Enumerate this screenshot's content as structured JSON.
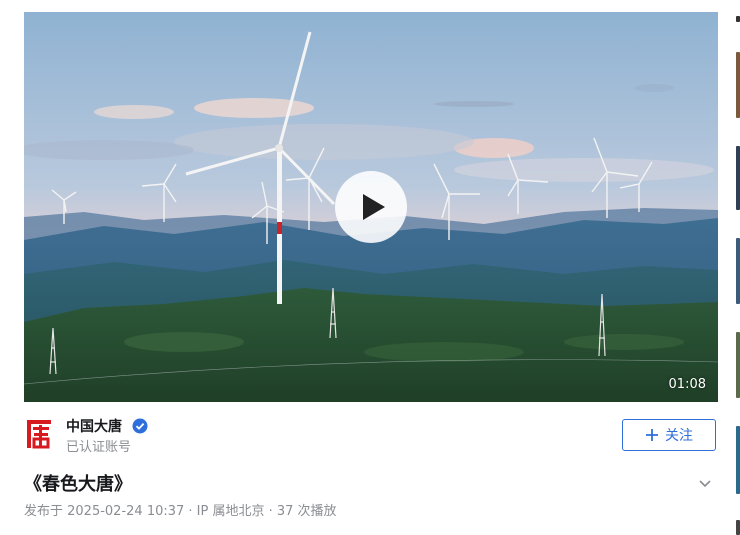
{
  "video": {
    "duration": "01:08"
  },
  "author": {
    "name": "中国大唐",
    "subtitle": "已认证账号"
  },
  "follow": {
    "label": "关注"
  },
  "post": {
    "title": "《春色大唐》",
    "meta": "发布于 2025-02-24 10:37 · IP 属地北京 · 37 次播放"
  },
  "icons": {
    "play": "play-icon",
    "verified": "verified-icon",
    "plus": "plus-icon",
    "expand": "chevron-down-icon",
    "logo": "datang-logo"
  },
  "colors": {
    "accent": "#2f6fdb",
    "brand_red": "#d71920",
    "text_primary": "#18191c",
    "text_secondary": "#8a8d92"
  }
}
